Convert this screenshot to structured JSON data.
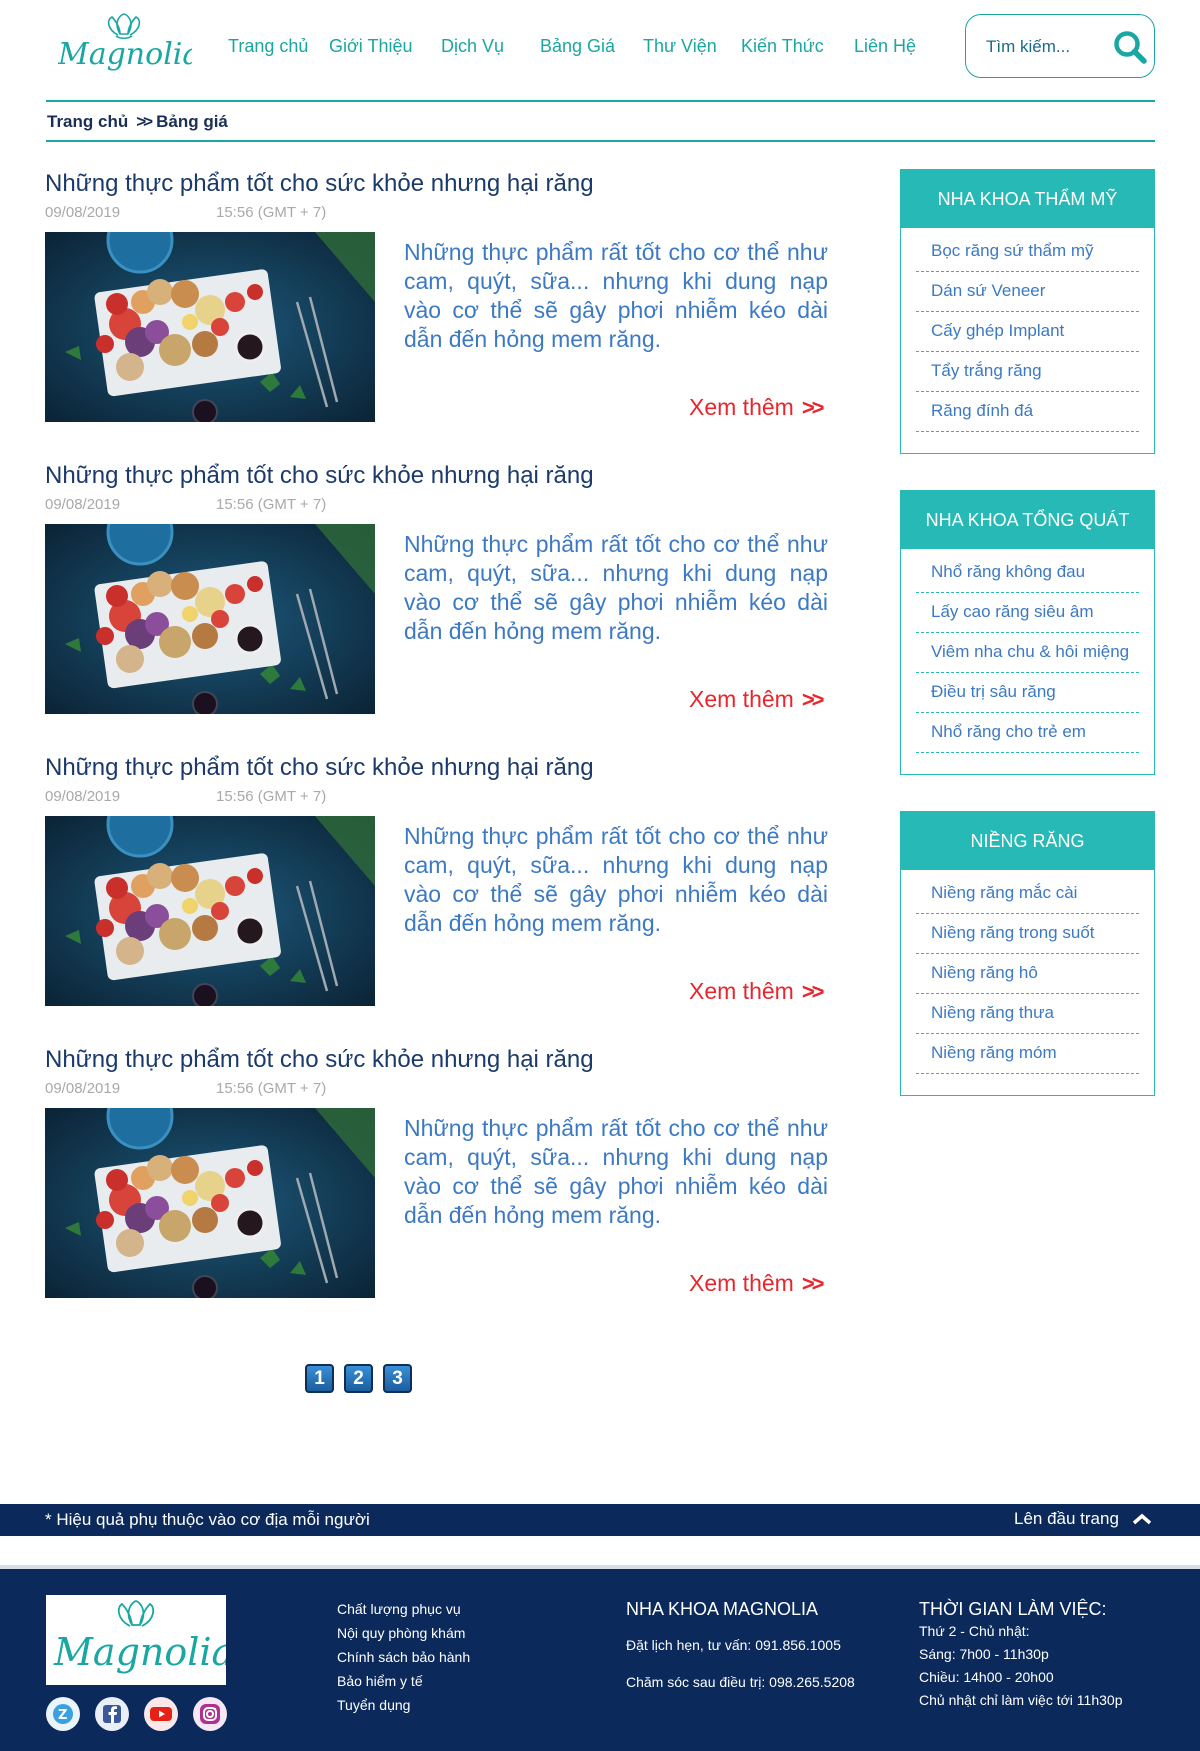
{
  "header": {
    "logo_text": "Magnolia",
    "nav": [
      "Trang chủ",
      "Giới Thiệu",
      "Dịch Vụ",
      "Bảng Giá",
      "Thư Viện",
      "Kiến Thức",
      "Liên Hệ"
    ],
    "search_placeholder": "Tìm kiếm...",
    "search_icon": "search-icon"
  },
  "breadcrumb": {
    "home": "Trang chủ",
    "current": "Bảng giá"
  },
  "articles": [
    {
      "title": "Những thực phẩm tốt cho sức khỏe nhưng hại răng",
      "date": "09/08/2019",
      "time": "15:56 (GMT + 7)",
      "excerpt": "Những thực phẩm rất tốt cho cơ thể như cam, quýt, sữa... nhưng khi dung nạp vào cơ thể sẽ gây phơi nhiễm kéo dài dẫn đến hỏng mem răng.",
      "more": "Xem thêm"
    },
    {
      "title": "Những thực phẩm tốt cho sức khỏe nhưng hại răng",
      "date": "09/08/2019",
      "time": "15:56 (GMT + 7)",
      "excerpt": "Những thực phẩm rất tốt cho cơ thể như cam, quýt, sữa... nhưng khi dung nạp vào cơ thể sẽ gây phơi nhiễm kéo dài dẫn đến hỏng mem răng.",
      "more": "Xem thêm"
    },
    {
      "title": "Những thực phẩm tốt cho sức khỏe nhưng hại răng",
      "date": "09/08/2019",
      "time": "15:56 (GMT + 7)",
      "excerpt": "Những thực phẩm rất tốt cho cơ thể như cam, quýt, sữa... nhưng khi dung nạp vào cơ thể sẽ gây phơi nhiễm kéo dài dẫn đến hỏng mem răng.",
      "more": "Xem thêm"
    },
    {
      "title": "Những thực phẩm tốt cho sức khỏe nhưng hại răng",
      "date": "09/08/2019",
      "time": "15:56 (GMT + 7)",
      "excerpt": "Những thực phẩm rất tốt cho cơ thể như cam, quýt, sữa... nhưng khi dung nạp vào cơ thể sẽ gây phơi nhiễm kéo dài dẫn đến hỏng mem răng.",
      "more": "Xem thêm"
    }
  ],
  "pagination": [
    "1",
    "2",
    "3"
  ],
  "sidebar": [
    {
      "title": "NHA KHOA THẨM MỸ",
      "items": [
        "Bọc răng sứ thẩm mỹ",
        "Dán sứ Veneer",
        "Cấy ghép Implant",
        "Tẩy trắng răng",
        "Răng đính đá"
      ]
    },
    {
      "title": "NHA KHOA TỔNG QUÁT",
      "items": [
        "Nhổ răng không đau",
        "Lấy cao răng siêu âm",
        "Viêm nha chu & hôi miệng",
        "Điều trị sâu răng",
        "Nhổ răng cho trẻ em"
      ]
    },
    {
      "title": "NIỀNG RĂNG",
      "items": [
        "Niềng răng mắc cài",
        "Niềng răng trong suốt",
        "Niềng răng hô",
        "Niềng răng thưa",
        "Niềng răng móm"
      ]
    }
  ],
  "band": {
    "note": "* Hiệu quả phụ thuộc vào cơ địa mỗi người",
    "back_to_top": "Lên đầu trang"
  },
  "footer": {
    "logo_text": "Magnolia",
    "socials": [
      "zalo-icon",
      "facebook-icon",
      "youtube-icon",
      "instagram-icon"
    ],
    "links": [
      "Chất lượng phục vụ",
      "Nội quy phòng khám",
      "Chính sách bảo hành",
      "Bảo hiểm y tế",
      "Tuyển dụng"
    ],
    "clinic": {
      "title": "NHA KHOA MAGNOLIA",
      "booking": "Đặt lịch hẹn, tư vấn: 091.856.1005",
      "aftercare": "Chăm sóc sau điều trị: 098.265.5208"
    },
    "hours": {
      "title": "THỜI GIAN LÀM VIỆC:",
      "days": "Thứ 2 - Chủ nhật:",
      "morning": "Sáng: 7h00 - 11h30p",
      "afternoon": "Chiều: 14h00 - 20h00",
      "sunday": "Chủ nhật chỉ làm việc tới 11h30p"
    }
  },
  "colors": {
    "teal": "#26b9b5",
    "navy": "#0b2a5b",
    "link_blue": "#3c79c4",
    "red": "#e8262c"
  }
}
